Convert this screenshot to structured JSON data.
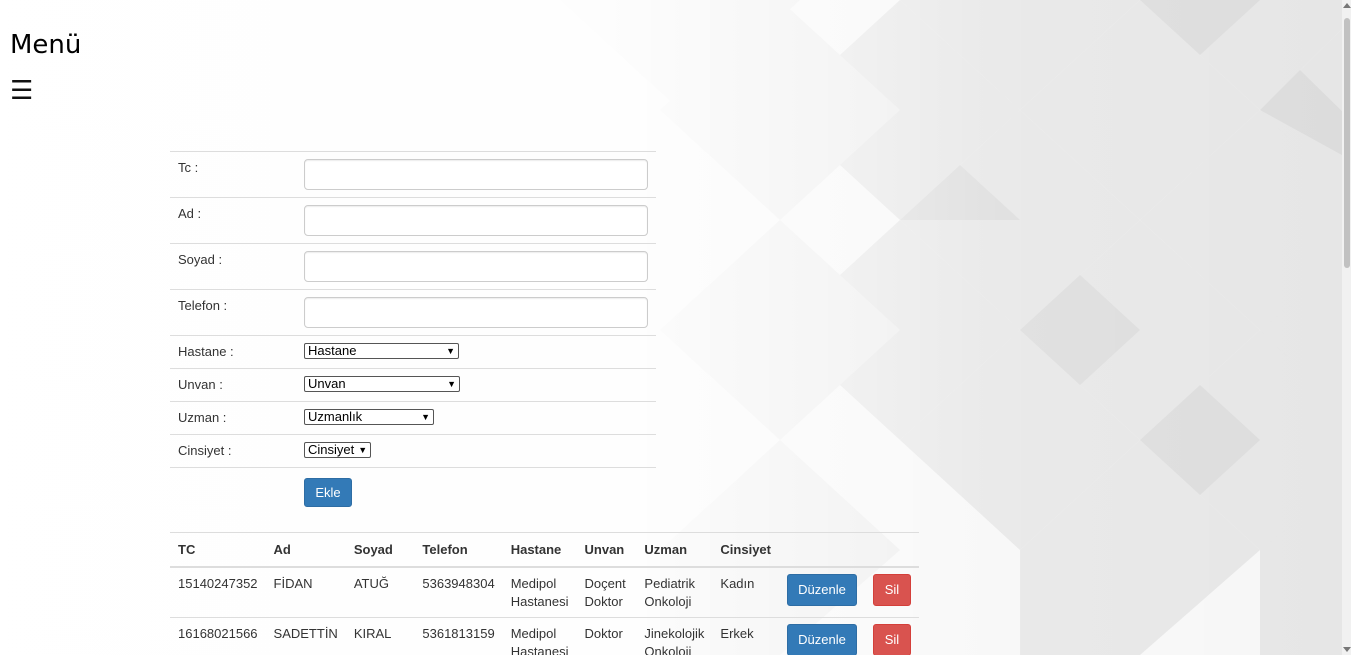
{
  "menu": {
    "title": "Menü",
    "hamburger_glyph": "☰",
    "icon": "hamburger-menu-icon"
  },
  "form": {
    "fields": [
      {
        "label": "Tc :",
        "value": ""
      },
      {
        "label": "Ad :",
        "value": ""
      },
      {
        "label": "Soyad :",
        "value": ""
      },
      {
        "label": "Telefon :",
        "value": ""
      }
    ],
    "selects": [
      {
        "label": "Hastane :",
        "selected": "Hastane"
      },
      {
        "label": "Unvan :",
        "selected": "Unvan"
      },
      {
        "label": "Uzman :",
        "selected": "Uzmanlık"
      },
      {
        "label": "Cinsiyet :",
        "selected": "Cinsiyet"
      }
    ],
    "submit_label": "Ekle"
  },
  "table": {
    "headers": [
      "TC",
      "Ad",
      "Soyad",
      "Telefon",
      "Hastane",
      "Unvan",
      "Uzman",
      "Cinsiyet"
    ],
    "rows": [
      {
        "tc": "15140247352",
        "ad": "FİDAN",
        "soyad": "ATUĞ",
        "telefon": "5363948304",
        "hastane_1": "Medipol",
        "hastane_2": "Hastanesi",
        "unvan_1": "Doçent",
        "unvan_2": "Doktor",
        "uzman_1": "Pediatrik",
        "uzman_2": "Onkoloji",
        "cinsiyet": "Kadın"
      },
      {
        "tc": "16168021566",
        "ad": "SADETTİN",
        "soyad": "KIRAL",
        "telefon": "5361813159",
        "hastane_1": "Medipol",
        "hastane_2": "Hastanesi",
        "unvan_1": "Doktor",
        "unvan_2": "",
        "uzman_1": "Jinekolojik",
        "uzman_2": "Onkoloji",
        "cinsiyet": "Erkek"
      }
    ],
    "edit_label": "Düzenle",
    "delete_label": "Sil"
  },
  "colors": {
    "primary": "#337ab7",
    "danger": "#d9534f"
  }
}
